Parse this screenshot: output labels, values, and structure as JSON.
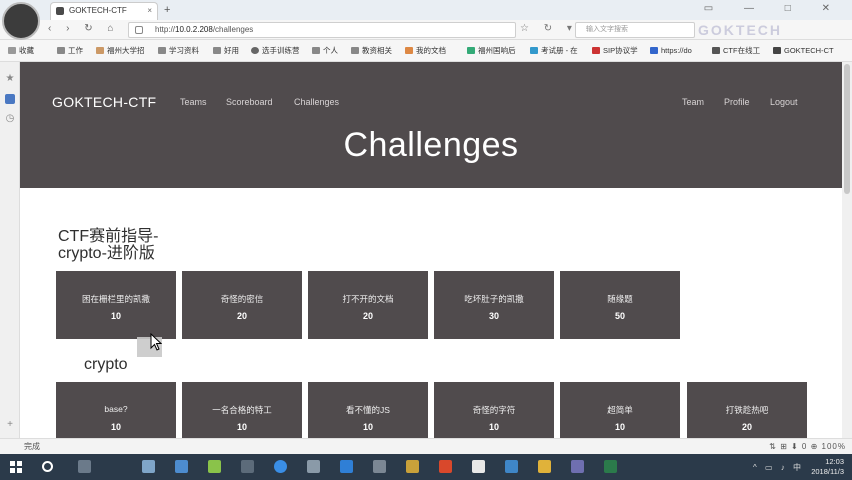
{
  "browser": {
    "tab_title": "GOKTECH-CTF",
    "tab_close": "×",
    "new_tab": "+",
    "window_controls": "▭ — □ ✕",
    "nav_icons": "‹ › ↻ ⌂",
    "url_host": "10.0.2.208",
    "url_prefix": "http://",
    "url_path": "/challenges",
    "addr_icons": "☆ ↻ ▾",
    "search_placeholder": "输入文字搜索",
    "watermark": "GOKTECH"
  },
  "bookmarks": [
    "收藏",
    "工作",
    "福州大学招",
    "学习资料",
    "好用",
    "选手训练营",
    "个人",
    "教资相关",
    "我的文档",
    "福州国响后",
    "考试册 - 在",
    "SIP协议学",
    "https://do",
    "CTF在线工",
    "GOKTECH-CT"
  ],
  "site": {
    "brand": "GOKTECH-CTF",
    "nav_left": [
      "Teams",
      "Scoreboard",
      "Challenges"
    ],
    "nav_right": [
      "Team",
      "Profile",
      "Logout"
    ],
    "page_title": "Challenges"
  },
  "categories": [
    {
      "title": "CTF赛前指导-crypto-进阶版",
      "title_line1": "CTF赛前指导-",
      "title_line2": "crypto-进阶版",
      "challenges": [
        {
          "name": "困在栅栏里的凯撒",
          "points": "10"
        },
        {
          "name": "奇怪的密信",
          "points": "20"
        },
        {
          "name": "打不开的文档",
          "points": "20"
        },
        {
          "name": "吃坏肚子的凯撒",
          "points": "30"
        },
        {
          "name": "随缘题",
          "points": "50"
        }
      ]
    },
    {
      "title": "crypto",
      "challenges": [
        {
          "name": "base?",
          "points": "10"
        },
        {
          "name": "一名合格的特工",
          "points": "10"
        },
        {
          "name": "看不懂的JS",
          "points": "10"
        },
        {
          "name": "奇怪的字符",
          "points": "10"
        },
        {
          "name": "超简单",
          "points": "10"
        },
        {
          "name": "打铁趁热吧",
          "points": "20"
        }
      ]
    }
  ],
  "statusbar": {
    "left": "完成",
    "right": "⇅ ⊞ ⬇ 0 ⊕ 100%"
  },
  "taskbar": {
    "tray": "^ ▭ ♪ 中",
    "time": "12:03",
    "date": "2018/11/3"
  }
}
